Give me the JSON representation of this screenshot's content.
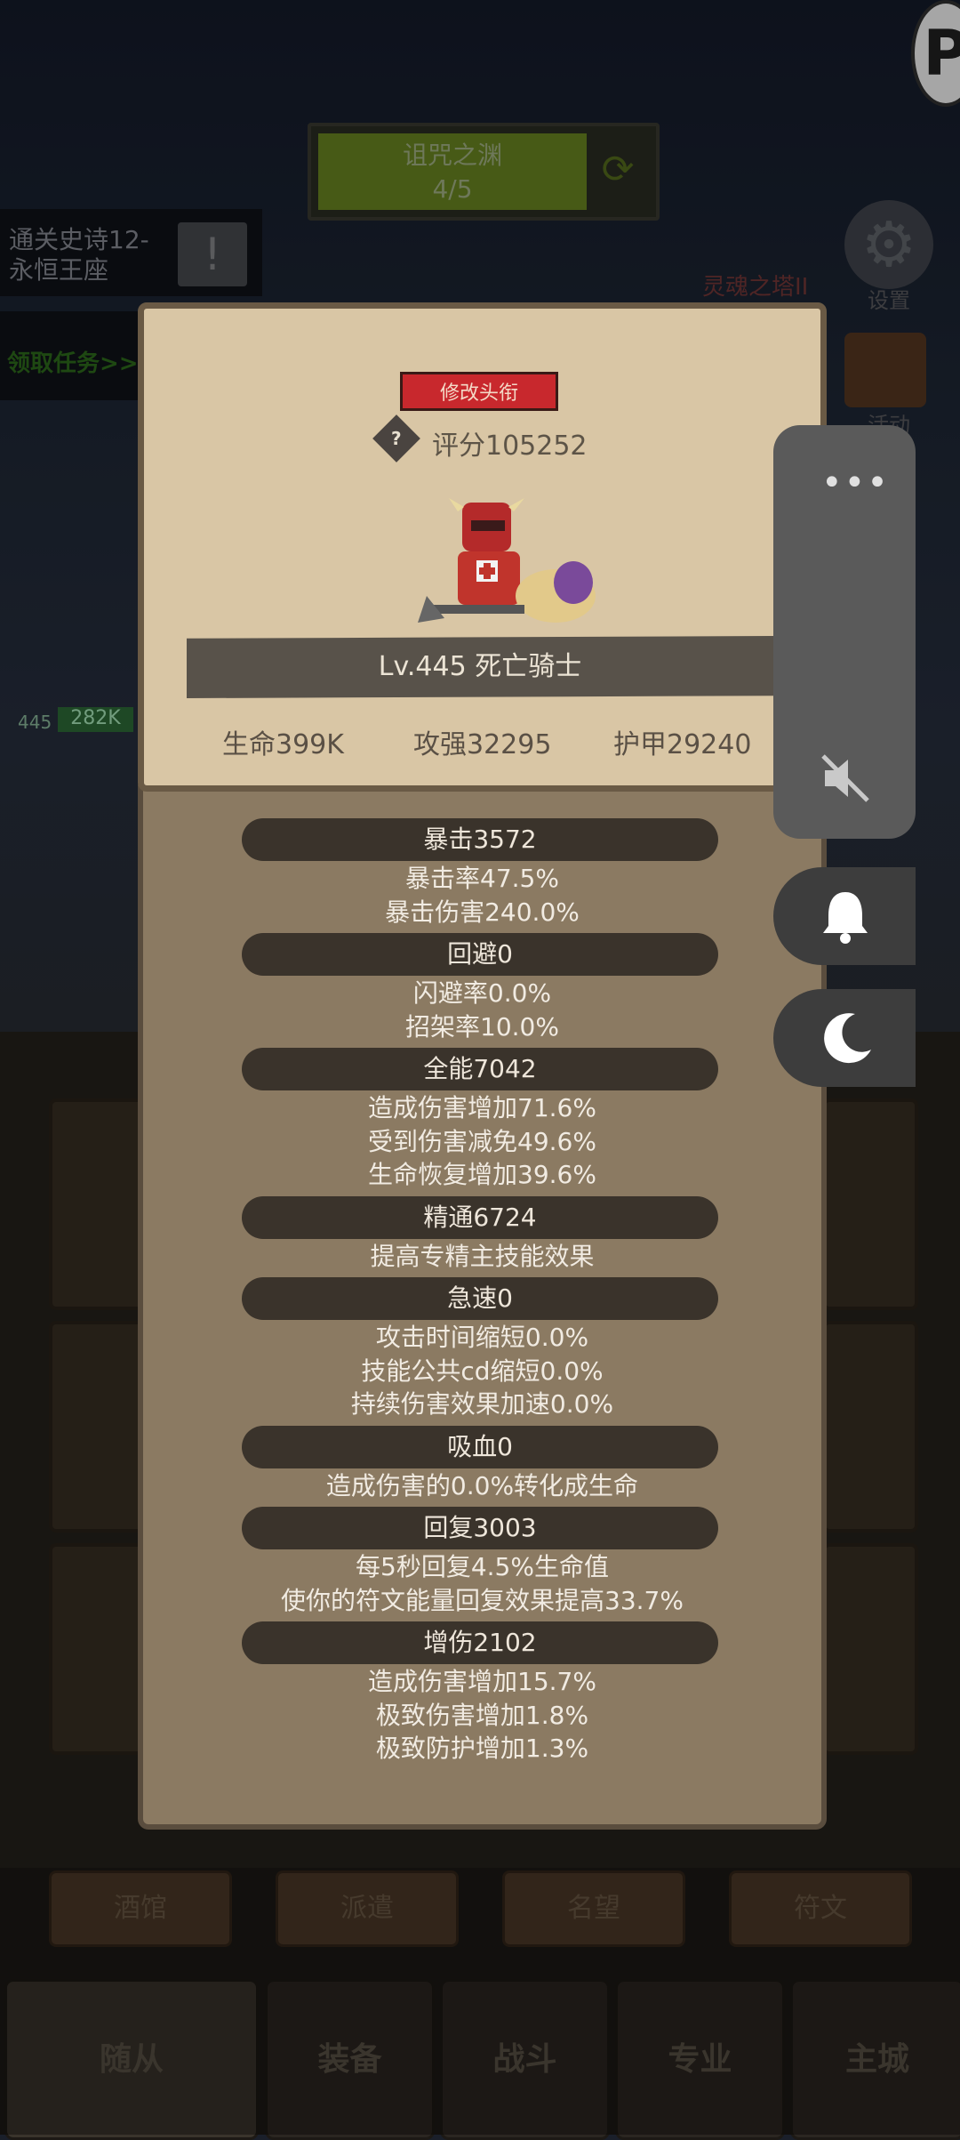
{
  "stage": {
    "name": "诅咒之渊",
    "progress": "4/5"
  },
  "quest": {
    "line1": "通关史诗12-",
    "line2": "永恒王座",
    "claim": "领取任务>>"
  },
  "side_icons": {
    "tower": "灵魂之塔II",
    "settings": "设置",
    "activity": "活动"
  },
  "popup": {
    "edit_title": "修改头衔",
    "score": "评分105252",
    "hero_name": "Lv.445 死亡骑士",
    "hp": "生命399K",
    "attack": "攻强32295",
    "armor": "护甲29240",
    "stats": [
      {
        "title": "暴击3572",
        "lines": [
          "暴击率47.5%",
          "暴击伤害240.0%"
        ]
      },
      {
        "title": "回避0",
        "lines": [
          "闪避率0.0%",
          "招架率10.0%"
        ]
      },
      {
        "title": "全能7042",
        "lines": [
          "造成伤害增加71.6%",
          "受到伤害减免49.6%",
          "生命恢复增加39.6%"
        ]
      },
      {
        "title": "精通6724",
        "lines": [
          "提高专精主技能效果"
        ]
      },
      {
        "title": "急速0",
        "lines": [
          "攻击时间缩短0.0%",
          "技能公共cd缩短0.0%",
          "持续伤害效果加速0.0%"
        ]
      },
      {
        "title": "吸血0",
        "lines": [
          "造成伤害的0.0%转化成生命"
        ]
      },
      {
        "title": "回复3003",
        "lines": [
          "每5秒回复4.5%生命值",
          "使你的符文能量回复效果提高33.7%"
        ]
      },
      {
        "title": "增伤2102",
        "lines": [
          "造成伤害增加15.7%",
          "极致伤害增加1.8%",
          "极致防护增加1.3%"
        ]
      }
    ]
  },
  "sub_tabs": [
    "酒馆",
    "派遣",
    "名望",
    "符文"
  ],
  "nav": [
    "随从",
    "装备",
    "战斗",
    "专业",
    "主城"
  ],
  "left_level": "445",
  "left_hp": "282K",
  "colors": {
    "popup_top": "#d9c6a5",
    "popup_body": "#8b7a62",
    "bar": "#3a332b",
    "title_btn": "#c8282d"
  }
}
